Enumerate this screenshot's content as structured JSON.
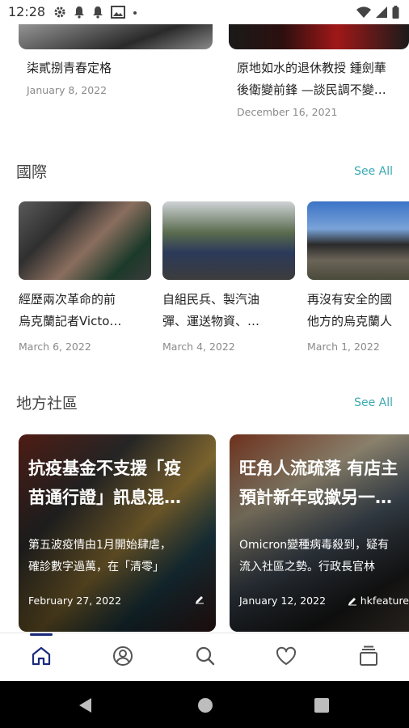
{
  "status_bar": {
    "time": "12:28"
  },
  "top_cards": [
    {
      "title": "柒貳捌青春定格",
      "date": "January 8, 2022"
    },
    {
      "title": "原地如水的退休教授 鍾劍華 後衛變前鋒 —談民調不變…",
      "title_line1": "原地如水的退休教授 鍾劍華",
      "title_line2": "後衛變前鋒 —談民調不變…",
      "date": "December 16, 2021"
    }
  ],
  "international": {
    "title": "國際",
    "see_all": "See All",
    "cards": [
      {
        "title_line1": "經歷兩次革命的前",
        "title_line2": "烏克蘭記者Victo…",
        "date": "March 6, 2022"
      },
      {
        "title_line1": "自組民兵、製汽油",
        "title_line2": "彈、運送物資、…",
        "date": "March 4, 2022"
      },
      {
        "title_line1": "再沒有安全的國",
        "title_line2": "他方的烏克蘭人",
        "date": "March 1, 2022"
      }
    ]
  },
  "local": {
    "title": "地方社區",
    "see_all": "See All",
    "cards": [
      {
        "title_line1": "抗疫基金不支援「疫",
        "title_line2": "苗通行證」訊息混…",
        "summary_line1": "第五波疫情由1月開始肆虐，",
        "summary_line2": "確診數字過萬，在「清零」",
        "date": "February 27, 2022",
        "author": ""
      },
      {
        "title_line1": "旺角人流疏落 有店主",
        "title_line2": "預計新年或撳另一…",
        "summary_line1": "Omicron變種病毒殺到，疑有",
        "summary_line2": "流入社區之勢。行政長官林",
        "date": "January 12, 2022",
        "author": "hkfeature"
      }
    ]
  },
  "bottom_nav": {
    "items": [
      {
        "icon": "home-icon",
        "active": true
      },
      {
        "icon": "profile-icon",
        "active": false
      },
      {
        "icon": "search-icon",
        "active": false
      },
      {
        "icon": "heart-icon",
        "active": false
      },
      {
        "icon": "stack-icon",
        "active": false
      }
    ]
  },
  "colors": {
    "accent": "#3aa9b3",
    "nav_active": "#1a2a7a",
    "date": "#8a8a8a"
  }
}
